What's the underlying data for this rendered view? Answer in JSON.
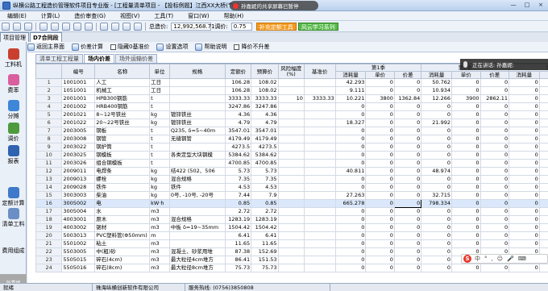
{
  "window": {
    "title": "纵横公路工程造价管理软件项目专业版 - [工程量清单项目 - 【投标例题】江西XX大桥(节选) - D7合同]",
    "minimize": "—",
    "maximize": "□",
    "close": "×"
  },
  "notice": {
    "text": "孙嘉妮的共享屏幕已暂停"
  },
  "menus": [
    "编辑(E)",
    "计算(L)",
    "造价审查(G)",
    "视图(V)",
    "工具(T)",
    "窗口(W)",
    "帮助(H)"
  ],
  "toolbar": {
    "total_label": "总造价:",
    "total_value": "12,992,568.71",
    "adjust_label": "调价:",
    "adjust_value": "0.75",
    "orange_button": "补充定额工具",
    "green_button": "风云学习系列"
  },
  "left_tabs": [
    "项目管理",
    "D7合同段"
  ],
  "sidebar": {
    "items": [
      "工料机",
      "费率",
      "分摊",
      "调价",
      "报表",
      "定额计算",
      "清单工料",
      "费用组成"
    ],
    "thumb": "孙嘉妮"
  },
  "actions": {
    "back": "返回主界面",
    "price_calc": "价差计算",
    "hide_zero": "隐藏0基准价",
    "settings": "设置选项",
    "help": "帮助说明",
    "lower_price": "降价不升差"
  },
  "subtabs": [
    "清单工程工程量",
    "场内价差",
    "场外运输价差"
  ],
  "table": {
    "headers_top": [
      "",
      "编号",
      "名称",
      "单位",
      "规格",
      "定额价",
      "预算价",
      "风险幅度(%)",
      "基准价",
      "第1季",
      "第2季",
      "第3季"
    ],
    "headers_q": [
      "消耗量",
      "单价",
      "价差"
    ],
    "rows": [
      {
        "n": "1",
        "code": "1001001",
        "name": "人工",
        "unit": "工日",
        "spec": "",
        "quota": "106.28",
        "budget": "108.02",
        "risk": "",
        "base": "",
        "q1": [
          "42.293",
          "0",
          "0"
        ],
        "q2": [
          "50.762",
          "0",
          "0"
        ],
        "q3": [
          "0",
          "0",
          "0"
        ]
      },
      {
        "n": "2",
        "code": "1051001",
        "name": "机械工",
        "unit": "工日",
        "spec": "",
        "quota": "106.28",
        "budget": "108.02",
        "risk": "",
        "base": "",
        "q1": [
          "9.111",
          "0",
          "0"
        ],
        "q2": [
          "10.934",
          "0",
          "0"
        ],
        "q3": [
          "0",
          "0",
          "0"
        ]
      },
      {
        "n": "3",
        "code": "2001001",
        "name": "HPB300钢筋",
        "unit": "t",
        "spec": "",
        "quota": "3333.33",
        "budget": "3333.33",
        "risk": "10",
        "base": "3333.33",
        "q1": [
          "10.221",
          "3800",
          "1362.84"
        ],
        "q2": [
          "12.266",
          "3900",
          "2862.11"
        ],
        "q3": [
          "0",
          "0",
          "0"
        ]
      },
      {
        "n": "4",
        "code": "2001002",
        "name": "HRB400钢筋",
        "unit": "t",
        "spec": "",
        "quota": "3247.86",
        "budget": "3247.86",
        "risk": "",
        "base": "",
        "q1": [
          "0",
          "0",
          "0"
        ],
        "q2": [
          "0",
          "0",
          "0"
        ],
        "q3": [
          "0",
          "0",
          "0"
        ]
      },
      {
        "n": "5",
        "code": "2001021",
        "name": "8~12号铁丝",
        "unit": "kg",
        "spec": "镀锌铁丝",
        "quota": "4.36",
        "budget": "4.36",
        "risk": "",
        "base": "",
        "q1": [
          "0",
          "0",
          "0"
        ],
        "q2": [
          "0",
          "0",
          "0"
        ],
        "q3": [
          "0",
          "0",
          "0"
        ]
      },
      {
        "n": "6",
        "code": "2001022",
        "name": "20~22号铁丝",
        "unit": "kg",
        "spec": "镀锌铁丝",
        "quota": "4.79",
        "budget": "4.79",
        "risk": "",
        "base": "",
        "q1": [
          "18.327",
          "0",
          "0"
        ],
        "q2": [
          "21.992",
          "0",
          "0"
        ],
        "q3": [
          "0",
          "0",
          "0"
        ]
      },
      {
        "n": "7",
        "code": "2003005",
        "name": "钢板",
        "unit": "t",
        "spec": "Q235, δ=5~40m",
        "quota": "3547.01",
        "budget": "3547.01",
        "risk": "",
        "base": "",
        "q1": [
          "0",
          "0",
          "0"
        ],
        "q2": [
          "0",
          "0",
          "0"
        ],
        "q3": [
          "0",
          "0",
          "0"
        ]
      },
      {
        "n": "8",
        "code": "2003008",
        "name": "钢管",
        "unit": "t",
        "spec": "无缝钢管",
        "quota": "4179.49",
        "budget": "4179.49",
        "risk": "",
        "base": "",
        "q1": [
          "0",
          "0",
          "0"
        ],
        "q2": [
          "0",
          "0",
          "0"
        ],
        "q3": [
          "0",
          "0",
          "0"
        ]
      },
      {
        "n": "9",
        "code": "2003022",
        "name": "钢护筒",
        "unit": "t",
        "spec": "",
        "quota": "4273.5",
        "budget": "4273.5",
        "risk": "",
        "base": "",
        "q1": [
          "0",
          "0",
          "0"
        ],
        "q2": [
          "0",
          "0",
          "0"
        ],
        "q3": [
          "0",
          "0",
          "0"
        ]
      },
      {
        "n": "10",
        "code": "2003025",
        "name": "钢模板",
        "unit": "t",
        "spec": "各类定型大块钢模",
        "quota": "5384.62",
        "budget": "5384.62",
        "risk": "",
        "base": "",
        "q1": [
          "0",
          "0",
          "0"
        ],
        "q2": [
          "0",
          "0",
          "0"
        ],
        "q3": [
          "0",
          "0",
          "0"
        ]
      },
      {
        "n": "11",
        "code": "2003026",
        "name": "组合钢模板",
        "unit": "t",
        "spec": "",
        "quota": "4700.85",
        "budget": "4700.85",
        "risk": "",
        "base": "",
        "q1": [
          "0",
          "0",
          "0"
        ],
        "q2": [
          "0",
          "0",
          "0"
        ],
        "q3": [
          "0",
          "0",
          "0"
        ]
      },
      {
        "n": "12",
        "code": "2009011",
        "name": "电焊条",
        "unit": "kg",
        "spec": "结422 (502、506",
        "quota": "5.73",
        "budget": "5.73",
        "risk": "",
        "base": "",
        "q1": [
          "40.811",
          "0",
          "0"
        ],
        "q2": [
          "48.974",
          "0",
          "0"
        ],
        "q3": [
          "0",
          "0",
          "0"
        ]
      },
      {
        "n": "13",
        "code": "2009013",
        "name": "螺栓",
        "unit": "kg",
        "spec": "混合规格",
        "quota": "7.35",
        "budget": "7.35",
        "risk": "",
        "base": "",
        "q1": [
          "0",
          "0",
          "0"
        ],
        "q2": [
          "0",
          "0",
          "0"
        ],
        "q3": [
          "0",
          "0",
          "0"
        ]
      },
      {
        "n": "14",
        "code": "2009028",
        "name": "铁件",
        "unit": "kg",
        "spec": "铁件",
        "quota": "4.53",
        "budget": "4.53",
        "risk": "",
        "base": "",
        "q1": [
          "0",
          "0",
          "0"
        ],
        "q2": [
          "0",
          "0",
          "0"
        ],
        "q3": [
          "0",
          "0",
          "0"
        ]
      },
      {
        "n": "15",
        "code": "3003003",
        "name": "柴油",
        "unit": "kg",
        "spec": "0号, -10号, -20号",
        "quota": "7.44",
        "budget": "7.9",
        "risk": "",
        "base": "",
        "q1": [
          "27.263",
          "0",
          "0"
        ],
        "q2": [
          "32.715",
          "0",
          "0"
        ],
        "q3": [
          "0",
          "0",
          "0"
        ]
      },
      {
        "n": "16",
        "code": "3005002",
        "name": "电",
        "unit": "kW·h",
        "spec": "",
        "quota": "0.85",
        "budget": "0.85",
        "risk": "",
        "base": "",
        "q1": [
          "665.278",
          "0",
          "0"
        ],
        "q2": [
          "798.334",
          "0",
          "0"
        ],
        "q3": [
          "0",
          "0",
          "0"
        ]
      },
      {
        "n": "17",
        "code": "3005004",
        "name": "水",
        "unit": "m3",
        "spec": "",
        "quota": "2.72",
        "budget": "2.72",
        "risk": "",
        "base": "",
        "q1": [
          "0",
          "0",
          "0"
        ],
        "q2": [
          "0",
          "0",
          "0"
        ],
        "q3": [
          "0",
          "0",
          "0"
        ]
      },
      {
        "n": "18",
        "code": "4003001",
        "name": "原木",
        "unit": "m3",
        "spec": "混合规格",
        "quota": "1283.19",
        "budget": "1283.19",
        "risk": "",
        "base": "",
        "q1": [
          "0",
          "0",
          "0"
        ],
        "q2": [
          "0",
          "0",
          "0"
        ],
        "q3": [
          "0",
          "0",
          "0"
        ]
      },
      {
        "n": "19",
        "code": "4003002",
        "name": "锯材",
        "unit": "m3",
        "spec": "中板 δ=19~35mm",
        "quota": "1504.42",
        "budget": "1504.42",
        "risk": "",
        "base": "",
        "q1": [
          "0",
          "0",
          "0"
        ],
        "q2": [
          "0",
          "0",
          "0"
        ],
        "q3": [
          "0",
          "0",
          "0"
        ]
      },
      {
        "n": "20",
        "code": "5003013",
        "name": "PVC塑料管(Φ50mm)",
        "unit": "m",
        "spec": "",
        "quota": "6.41",
        "budget": "6.41",
        "risk": "",
        "base": "",
        "q1": [
          "0",
          "0",
          "0"
        ],
        "q2": [
          "0",
          "0",
          "0"
        ],
        "q3": [
          "0",
          "0",
          "0"
        ]
      },
      {
        "n": "21",
        "code": "5501002",
        "name": "粘土",
        "unit": "m3",
        "spec": "",
        "quota": "11.65",
        "budget": "11.65",
        "risk": "",
        "base": "",
        "q1": [
          "0",
          "0",
          "0"
        ],
        "q2": [
          "0",
          "0",
          "0"
        ],
        "q3": [
          "0",
          "0",
          "0"
        ]
      },
      {
        "n": "22",
        "code": "5503005",
        "name": "中(粗)砂",
        "unit": "m3",
        "spec": "混凝土、砂浆用堆",
        "quota": "87.38",
        "budget": "152.69",
        "risk": "",
        "base": "",
        "q1": [
          "0",
          "0",
          "0"
        ],
        "q2": [
          "0",
          "0",
          "0"
        ],
        "q3": [
          "0",
          "0",
          "0"
        ]
      },
      {
        "n": "23",
        "code": "5505015",
        "name": "碎石(4cm)",
        "unit": "m3",
        "spec": "最大粒径4cm堆方",
        "quota": "86.41",
        "budget": "151.53",
        "risk": "",
        "base": "",
        "q1": [
          "0",
          "0",
          "0"
        ],
        "q2": [
          "0",
          "0",
          "0"
        ],
        "q3": [
          "0",
          "0",
          "0"
        ]
      },
      {
        "n": "24",
        "code": "5505016",
        "name": "碎石(8cm)",
        "unit": "m3",
        "spec": "最大粒径8cm堆方",
        "quota": "75.73",
        "budget": "75.73",
        "risk": "",
        "base": "",
        "q1": [
          "0",
          "0",
          "0"
        ],
        "q2": [
          "0",
          "0",
          "0"
        ],
        "q3": [
          "0",
          "0",
          "0"
        ]
      }
    ]
  },
  "voice": {
    "text": "正在讲话: 孙嘉妮:"
  },
  "ime": {
    "logo": "S",
    "items": [
      "中",
      "°",
      ",",
      "☺",
      "🎤",
      "⌨"
    ]
  },
  "status": {
    "ready": "就绪",
    "company": "珠海纵横创新软件有限公司",
    "service": "服务热线: (0756)3850808"
  }
}
